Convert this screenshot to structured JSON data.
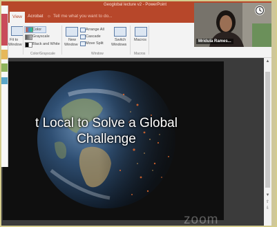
{
  "window": {
    "title": "Geoglobal lecture v2 - PowerPoint"
  },
  "ribbon_tabs": {
    "view": "View",
    "acrobat": "Acrobat",
    "tell_me": "Tell me what you want to do..."
  },
  "ribbon": {
    "fit_to_window_line1": "Fit to",
    "fit_to_window_line2": "Window",
    "color": "Color",
    "grayscale": "Grayscale",
    "black_and_white": "Black and White",
    "color_grayscale_group": "Color/Grayscale",
    "new_window_line1": "New",
    "new_window_line2": "Window",
    "arrange_all": "Arrange All",
    "cascade": "Cascade",
    "move_split": "Move Split",
    "switch_windows_line1": "Switch",
    "switch_windows_line2": "Windows",
    "window_group": "Window",
    "macros": "Macros",
    "macros_group": "Macros"
  },
  "slide": {
    "title_line1": "t Local to Solve a Global",
    "title_line2": "Challenge"
  },
  "participant": {
    "name": "Mridula Rames..."
  },
  "watermark": {
    "text": "zoom"
  },
  "colors": {
    "ribbon_accent": "#b7472a",
    "ribbon_bg": "#f3f3f3",
    "slide_bg": "#0f0f0f",
    "zoom_border": "#d4cc8e"
  },
  "icons": {
    "fit_to_window": "fit-window-icon",
    "new_window": "new-window-icon",
    "arrange_all": "arrange-all-icon",
    "cascade": "cascade-icon",
    "move_split": "move-split-icon",
    "switch_windows": "switch-windows-icon",
    "macros": "macros-icon",
    "tell_me": "lightbulb-icon",
    "clock": "clock-icon"
  }
}
